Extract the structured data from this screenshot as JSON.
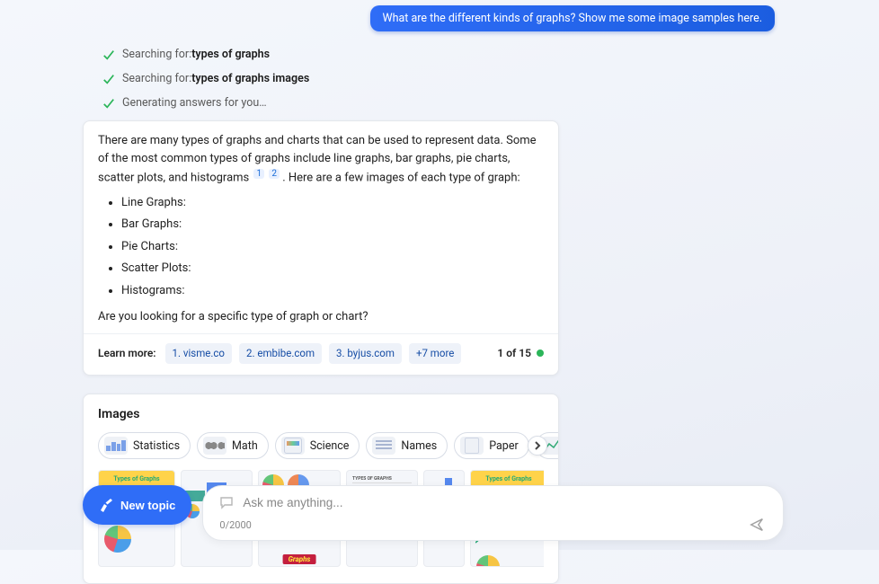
{
  "user_message": "What are the different kinds of graphs? Show me some image samples here.",
  "progress": [
    {
      "prefix": "Searching for: ",
      "bold": "types of graphs"
    },
    {
      "prefix": "Searching for: ",
      "bold": "types of graphs images"
    },
    {
      "prefix": "Generating answers for you…",
      "bold": ""
    }
  ],
  "answer": {
    "intro_a": "There are many types of graphs and charts that can be used to represent data. Some of the most common types of graphs include line graphs, bar graphs, pie charts, scatter plots, and histograms",
    "intro_b": ". Here are a few images of each type of graph:",
    "cite1": "1",
    "cite2": "2",
    "items": [
      "Line Graphs:",
      "Bar Graphs:",
      "Pie Charts:",
      "Scatter Plots:",
      "Histograms:"
    ],
    "closing": "Are you looking for a specific type of graph or chart?"
  },
  "learn_more": {
    "label": "Learn more:",
    "refs": [
      "1. visme.co",
      "2. embibe.com",
      "3. byjus.com",
      "+7 more"
    ],
    "counter": "1 of 15"
  },
  "images_section": {
    "title": "Images",
    "filters": [
      "Statistics",
      "Math",
      "Science",
      "Names",
      "Paper",
      "Line"
    ],
    "graphs_label": "Graphs"
  },
  "bottom": {
    "new_topic": "New topic",
    "placeholder": "Ask me anything...",
    "char_count": "0/2000"
  }
}
